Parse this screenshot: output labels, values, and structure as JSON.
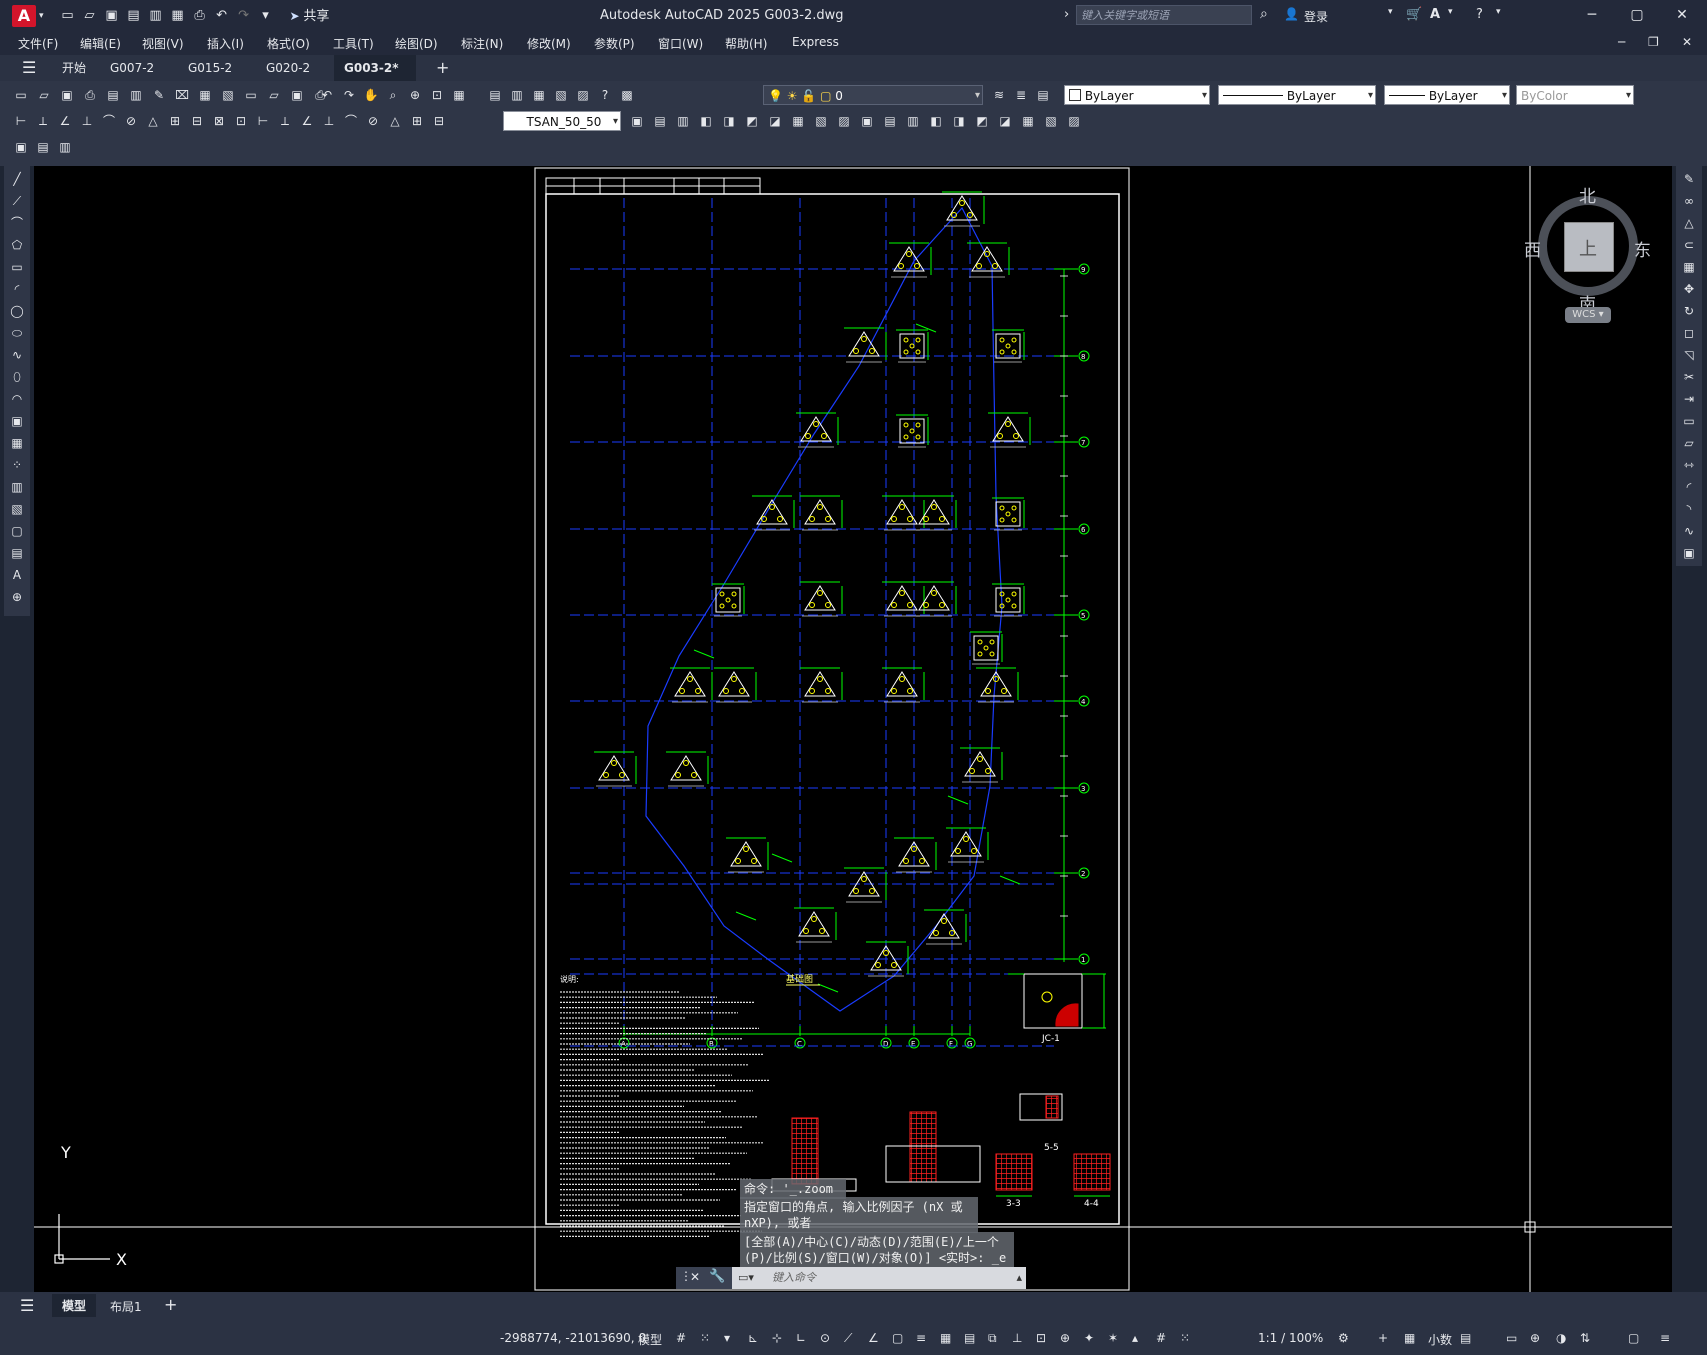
{
  "app": {
    "logo": "A",
    "title": "Autodesk AutoCAD 2025    G003-2.dwg",
    "share": "共享",
    "search_placeholder": "键入关键字或短语",
    "login": "登录"
  },
  "menu": [
    "文件(F)",
    "编辑(E)",
    "视图(V)",
    "插入(I)",
    "格式(O)",
    "工具(T)",
    "绘图(D)",
    "标注(N)",
    "修改(M)",
    "参数(P)",
    "窗口(W)",
    "帮助(H)",
    "Express"
  ],
  "tabs": [
    {
      "label": "开始"
    },
    {
      "label": "G007-2"
    },
    {
      "label": "G015-2"
    },
    {
      "label": "G020-2"
    },
    {
      "label": "G003-2*",
      "active": true
    }
  ],
  "toolbar": {
    "layer_value": "0",
    "color_value": "ByLayer",
    "linetype_value": "ByLayer",
    "lineweight_value": "ByLayer",
    "plotstyle_value": "ByColor",
    "dimstyle_value": "TSAN_50_50"
  },
  "viewcube": {
    "north": "北",
    "south": "南",
    "east": "东",
    "west": "西",
    "top": "上",
    "wcs": "WCS"
  },
  "command": {
    "history": [
      "命令: '_.zoom",
      "指定窗口的角点, 输入比例因子 (nX 或 nXP), 或者",
      "[全部(A)/中心(C)/动态(D)/范围(E)/上一个(P)/比例(S)/窗口(W)/对象(O)] <实时>: _e"
    ],
    "input_placeholder": "键入命令"
  },
  "drawing": {
    "plan_title": "基础图",
    "detail_title": "JC-1",
    "notes_title": "说明:",
    "section_labels": [
      "5-5",
      "3-3",
      "4-4"
    ],
    "col_axes": [
      "A",
      "B",
      "C",
      "D",
      "E",
      "F",
      "G"
    ],
    "row_axes": [
      "9",
      "8",
      "7",
      "6",
      "5",
      "4",
      "3",
      "2",
      "1"
    ]
  },
  "layout_tabs": [
    "模型",
    "布局1"
  ],
  "status": {
    "coords": "-2988774, -21013690, 0",
    "mode": "模型",
    "scale": "1:1 / 100%",
    "units": "小数"
  },
  "ucs": {
    "x": "X",
    "y": "Y"
  }
}
